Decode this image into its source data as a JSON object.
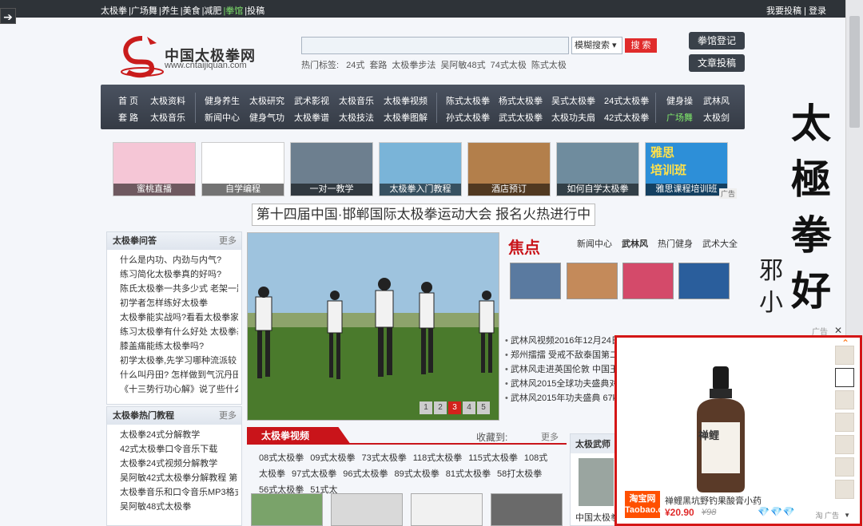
{
  "topbar": {
    "left_links": [
      "太极拳",
      "|广场舞",
      "|养生",
      "|美食",
      "|减肥",
      "|拳馆",
      "|投稿"
    ],
    "highlight_index": 5,
    "right": "我要投稿 | 登录"
  },
  "logo": {
    "name": "中国太极拳网",
    "url": "www.cntaijiquan.com"
  },
  "search": {
    "placeholder": "",
    "mode": "模糊搜索",
    "button": "搜 索",
    "hot_label": "热门标签:",
    "hot_tags": [
      "24式",
      "套路",
      "太极拳步法",
      "吴阿敏48式",
      "74式太极",
      "陈式太极"
    ]
  },
  "header_buttons": [
    "拳馆登记",
    "文章投稿"
  ],
  "nav": {
    "row1": [
      "首 页",
      "太极资料",
      "健身养生",
      "太极研究",
      "武术影视",
      "太极音乐",
      "太极拳视频",
      "陈式太极拳",
      "杨式太极拳",
      "吴式太极拳",
      "24式太极拳",
      "健身操",
      "武林风"
    ],
    "row2": [
      "套 路",
      "太极音乐",
      "新闻中心",
      "健身气功",
      "太极拳谱",
      "太极技法",
      "太极拳图解",
      "孙式太极拳",
      "武式太极拳",
      "太极功夫扇",
      "42式太极拳",
      "广场舞",
      "太极剑"
    ],
    "row2_green_index": 11
  },
  "thumbs": [
    {
      "caption": "蜜桃直播",
      "color": "#f5c6d6"
    },
    {
      "caption": "自学编程",
      "color": "#ffffff"
    },
    {
      "caption": "一对一教学",
      "color": "#6d7f8f"
    },
    {
      "caption": "太极拳入门教程",
      "color": "#7ab4d8"
    },
    {
      "caption": "酒店预订",
      "color": "#b37f4b"
    },
    {
      "caption": "如何自学太极拳",
      "color": "#6f8c9e"
    },
    {
      "caption": "雅思课程培训班",
      "color": "#2d8fd8"
    }
  ],
  "ad_tag": "广告",
  "ad_thumb_text": "雅思\n培训班",
  "banner_title": "第十四届中国·邯郸国际太极拳运动大会 报名火热进行中",
  "qa_box": {
    "title": "太极拳问答",
    "more": "更多",
    "items": [
      "什么是内功、内劲与内气?",
      "练习简化太极拳真的好吗?",
      "陈氏太极拳一共多少式 老架一路",
      "初学者怎样练好太极拳",
      "太极拳能实战吗?看看太极拳家怎",
      "练习太极拳有什么好处 太极拳基",
      "膝盖痛能练太极拳吗?",
      "初学太极拳,先学习哪种流派较",
      "什么叫丹田? 怎样做到气沉丹田?",
      "《十三势行功心解》说了些什么?"
    ]
  },
  "tutorial_box": {
    "title": "太极拳热门教程",
    "more": "更多",
    "items": [
      "太极拳24式分解教学",
      "42式太极拳口令音乐下载",
      "太极拳24式视频分解教学",
      "吴阿敏42式太极拳分解教程 第一",
      "太极拳音乐和口令音乐MP3格式--",
      "吴阿敏48式太极拳"
    ]
  },
  "pager": [
    "1",
    "2",
    "3",
    "4",
    "5"
  ],
  "pager_active_index": 2,
  "focus": {
    "title": "焦点",
    "tabs": [
      "新闻中心",
      "武林风",
      "热门健身",
      "武术大全"
    ],
    "active_tab_index": 1,
    "news": [
      "武林风视频2016年12月24日完整",
      "郑州擂擂 受戒不敌泰国第二场",
      "武林风走进英国伦敦 中国王鹏飞",
      "武林风2015全球功夫盛典对阵表",
      "武林风2015年功夫盛典 67kg/人"
    ]
  },
  "video": {
    "tab": "太极拳视频",
    "collect": "收藏到:",
    "more": "更多",
    "links": [
      "08式太极拳",
      "09式太极拳",
      "73式太极拳",
      "118式太极拳",
      "115式太极拳",
      "108式太极拳",
      "97式太极拳",
      "96式太极拳",
      "89式太极拳",
      "81式太极拳",
      "58打太极拳",
      "56式太极拳",
      "51式太"
    ]
  },
  "martial": {
    "title": "太极武师",
    "caption": "中国太极拳"
  },
  "calligraphy": [
    "太",
    "極",
    "拳",
    "好"
  ],
  "calligraphy_side": "邪\n小",
  "popup": {
    "ad_label": "广告",
    "close": "✕",
    "shop_logo": "淘宝网\nTaobao.com",
    "product_name": "禅鲤黑坑野钓果酸膏小药",
    "price": "¥20.90",
    "old_price": "¥98",
    "diamonds": "💎💎💎",
    "bottle_label": "禅鲤",
    "ad_small": "淘 广告"
  }
}
